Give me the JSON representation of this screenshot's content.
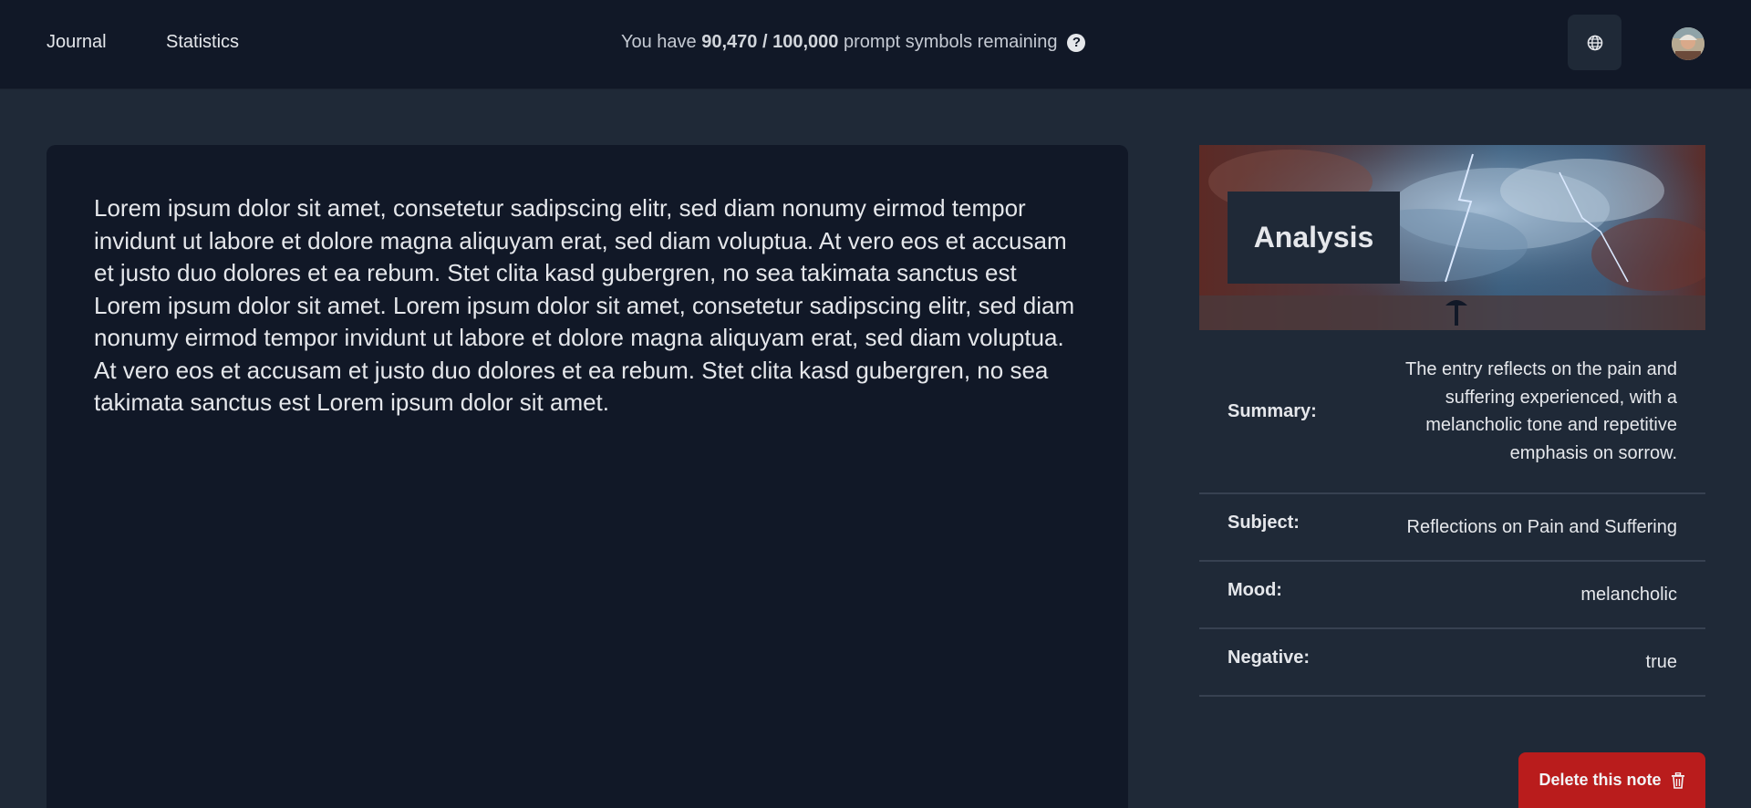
{
  "nav": {
    "journal": "Journal",
    "statistics": "Statistics"
  },
  "quota": {
    "prefix": "You have",
    "used": "90,470 / 100,000",
    "suffix": "prompt symbols remaining",
    "help_icon": "question-circle-icon"
  },
  "header_icons": {
    "language": "globe-icon",
    "avatar": "user-avatar"
  },
  "editor": {
    "text": "Lorem ipsum dolor sit amet, consetetur sadipscing elitr, sed diam nonumy eirmod tempor invidunt ut labore et dolore magna aliquyam erat, sed diam voluptua. At vero eos et accusam et justo duo dolores et ea rebum. Stet clita kasd gubergren, no sea takimata sanctus est Lorem ipsum dolor sit amet. Lorem ipsum dolor sit amet, consetetur sadipscing elitr, sed diam nonumy eirmod tempor invidunt ut labore et dolore magna aliquyam erat, sed diam voluptua. At vero eos et accusam et justo duo dolores et ea rebum. Stet clita kasd gubergren, no sea takimata sanctus est Lorem ipsum dolor sit amet."
  },
  "analysis": {
    "title": "Analysis",
    "summary_label": "Summary:",
    "summary_value": "The entry reflects on the pain and suffering experienced, with a melancholic tone and repetitive emphasis on sorrow.",
    "subject_label": "Subject:",
    "subject_value": "Reflections on Pain and Suffering",
    "mood_label": "Mood:",
    "mood_value": "melancholic",
    "negative_label": "Negative:",
    "negative_value": "true"
  },
  "actions": {
    "delete_label": "Delete this note",
    "delete_icon": "trash-icon"
  },
  "colors": {
    "topbar": "#111827",
    "background": "#1f2937",
    "card": "#111827",
    "danger": "#b91c1c"
  }
}
